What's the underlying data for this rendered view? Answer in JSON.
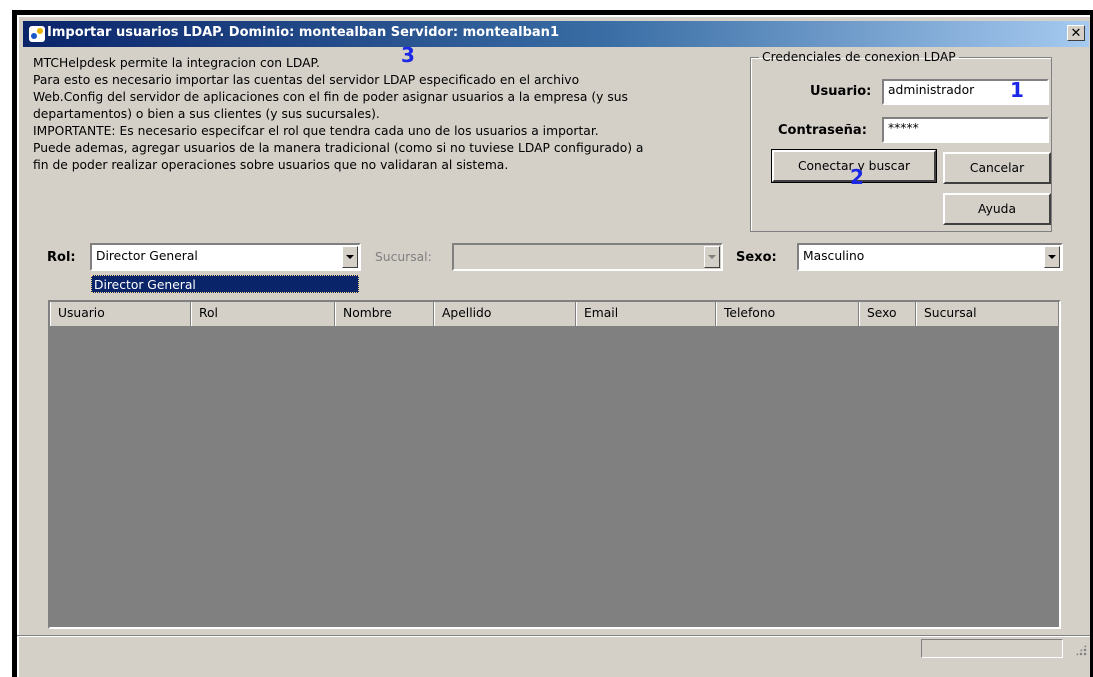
{
  "window": {
    "title": "Importar usuarios LDAP. Dominio: montealban Servidor: montealban1",
    "close_label": "✕"
  },
  "info": {
    "lines": [
      "MTCHelpdesk permite la integracion con LDAP.",
      "Para esto es necesario importar las cuentas del servidor LDAP especificado en el archivo",
      "Web.Config del servidor de aplicaciones con el fin de poder asignar usuarios a la empresa (y sus",
      "departamentos) o bien a sus clientes (y sus sucursales).",
      "IMPORTANTE: Es necesario especifcar el rol que tendra cada uno de los usuarios a importar.",
      "Puede ademas, agregar usuarios de la manera tradicional (como si no tuviese LDAP configurado) a",
      "fin de poder realizar operaciones sobre usuarios que no validaran al sistema."
    ]
  },
  "annotations": {
    "one": "1",
    "two": "2",
    "three": "3"
  },
  "credentials": {
    "legend": "Credenciales de conexion LDAP",
    "user_label": "Usuario:",
    "user_value": "administrador",
    "password_label": "Contraseña:",
    "password_value": "*****",
    "connect_label": "Conectar y buscar",
    "cancel_label": "Cancelar",
    "help_label": "Ayuda"
  },
  "filters": {
    "rol_label": "Rol:",
    "rol_value": "Director General",
    "rol_dropdown_item": "Director General",
    "sucursal_label": "Sucursal:",
    "sucursal_value": "",
    "sexo_label": "Sexo:",
    "sexo_value": "Masculino"
  },
  "grid": {
    "columns": [
      "Usuario",
      "Rol",
      "Nombre",
      "Apellido",
      "Email",
      "Telefono",
      "Sexo",
      "Sucursal"
    ]
  }
}
